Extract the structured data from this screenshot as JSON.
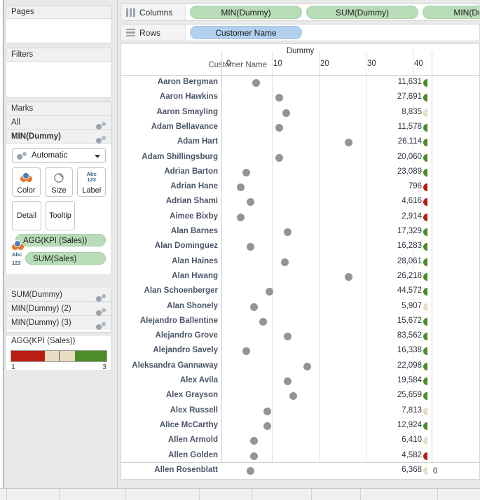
{
  "left_panel": {
    "pages": {
      "title": "Pages"
    },
    "filters": {
      "title": "Filters"
    },
    "marks": {
      "title": "Marks",
      "rows": [
        {
          "label": "All",
          "icon": "marks-dots-icon",
          "bold": false
        },
        {
          "label": "MIN(Dummy)",
          "icon": "marks-dots-icon",
          "bold": true
        }
      ],
      "mark_type": "Automatic",
      "mark_type_icon": "marks-dots-icon",
      "buttons": [
        {
          "label": "Color",
          "icon": "color-palette-icon"
        },
        {
          "label": "Size",
          "icon": "size-circle-icon"
        },
        {
          "label": "Label",
          "icon": "abc123-label-icon"
        },
        {
          "label": "Detail",
          "icon": "detail-icon"
        },
        {
          "label": "Tooltip",
          "icon": "tooltip-icon"
        }
      ],
      "encoding_pills": [
        {
          "icon": "color-palette-icon",
          "label": "AGG(KPI (Sales))"
        },
        {
          "icon": "abc123-label-icon",
          "label": "SUM(Sales)"
        }
      ]
    },
    "extra_marks_rows": [
      {
        "label": "SUM(Dummy)",
        "icon": "marks-dots-icon"
      },
      {
        "label": "MIN(Dummy) (2)",
        "icon": "marks-dots-icon"
      },
      {
        "label": "MIN(Dummy) (3)",
        "icon": "marks-dots-icon"
      }
    ],
    "legend": {
      "title": "AGG(KPI (Sales))",
      "min_label": "1",
      "max_label": "3",
      "colors": [
        "#bb1d13",
        "#e8dcc2",
        "#4d8c27"
      ]
    }
  },
  "shelves": {
    "columns": {
      "label": "Columns",
      "icon": "columns-icon",
      "pills": [
        "MIN(Dummy)",
        "SUM(Dummy)",
        "MIN(Dummy)"
      ]
    },
    "rows": {
      "label": "Rows",
      "icon": "rows-icon",
      "pills": [
        "Customer Name"
      ]
    }
  },
  "chart_data": {
    "type": "scatter",
    "title": "Dummy",
    "xlabel": "Dummy",
    "ylabel": "Customer Name",
    "row_header_label": "Customer Name",
    "xlim": [
      0,
      45
    ],
    "xticks": [
      0,
      10,
      20,
      30,
      40
    ],
    "xtick_labels": [
      "0",
      "10",
      "20",
      "30",
      "40"
    ],
    "grid": true,
    "legend_position": "left-panel",
    "bottom_axis_label": "0",
    "value_series_name": "SUM(Sales)",
    "dot_series_name": "MIN(Dummy)",
    "kpi_series_name": "AGG(KPI (Sales))",
    "kpi_colors": {
      "low": "#bb1d13",
      "mid": "#e8dcc2",
      "high": "#4d8c27"
    },
    "dot_color": "#949494",
    "categories": [
      "Aaron Bergman",
      "Aaron Hawkins",
      "Aaron Smayling",
      "Adam Bellavance",
      "Adam Hart",
      "Adam Shillingsburg",
      "Adrian Barton",
      "Adrian Hane",
      "Adrian Shami",
      "Aimee Bixby",
      "Alan Barnes",
      "Alan Dominguez",
      "Alan Haines",
      "Alan Hwang",
      "Alan Schoenberger",
      "Alan Shonely",
      "Alejandro Ballentine",
      "Alejandro Grove",
      "Alejandro Savely",
      "Aleksandra Gannaway",
      "Alex Avila",
      "Alex Grayson",
      "Alex Russell",
      "Alice McCarthy",
      "Allen Armold",
      "Allen Golden",
      "Allen Rosenblatt"
    ],
    "x": [
      6.6,
      11.6,
      13.1,
      11.6,
      26.3,
      11.6,
      4.6,
      3.3,
      5.4,
      3.3,
      13.4,
      5.4,
      12.7,
      26.3,
      9.5,
      6.2,
      8.1,
      13.4,
      4.6,
      17.5,
      13.4,
      14.5,
      9.1,
      9.1,
      6.2,
      6.2,
      5.4
    ],
    "values": [
      11631,
      27691,
      8835,
      11578,
      26114,
      20060,
      23089,
      796,
      4616,
      2914,
      17329,
      16283,
      28061,
      26218,
      44572,
      5907,
      15672,
      83562,
      16338,
      22098,
      19584,
      25659,
      7813,
      12924,
      6410,
      4582,
      6368
    ],
    "value_labels": [
      "11,631",
      "27,691",
      "8,835",
      "11,578",
      "26,114",
      "20,060",
      "23,089",
      "796",
      "4,616",
      "2,914",
      "17,329",
      "16,283",
      "28,061",
      "26,218",
      "44,572",
      "5,907",
      "15,672",
      "83,562",
      "16,338",
      "22,098",
      "19,584",
      "25,659",
      "7,813",
      "12,924",
      "6,410",
      "4,582",
      "6,368"
    ],
    "kpi_status": [
      "high",
      "high",
      "mid",
      "high",
      "high",
      "high",
      "high",
      "low",
      "low",
      "low",
      "high",
      "high",
      "high",
      "high",
      "high",
      "mid",
      "high",
      "high",
      "high",
      "high",
      "high",
      "high",
      "mid",
      "high",
      "mid",
      "low",
      "mid"
    ]
  }
}
